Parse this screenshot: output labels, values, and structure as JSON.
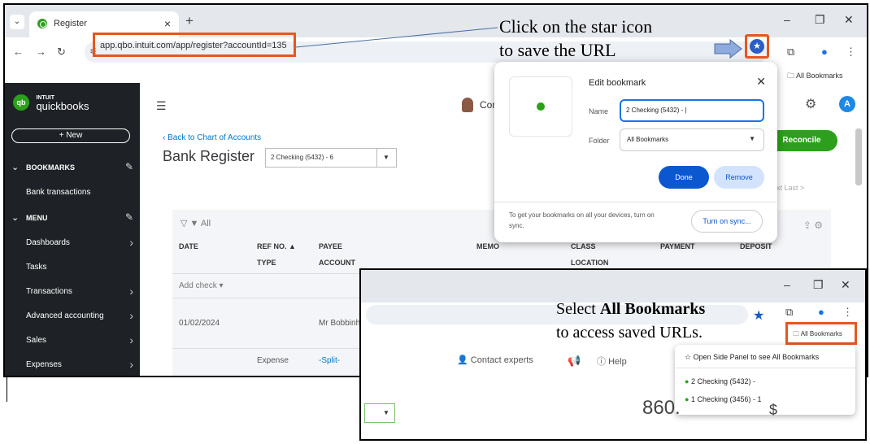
{
  "tab": {
    "title": "Register",
    "close": "×",
    "new": "+"
  },
  "window": {
    "minimize": "–",
    "restore": "❐",
    "close": "✕"
  },
  "address": {
    "url": "app.qbo.intuit.com/app/register?accountId=135"
  },
  "annotation_top": {
    "line1": "Click on the star icon",
    "line2": "to save the URL"
  },
  "bookmarks_bar": {
    "folder": "All Bookmarks"
  },
  "sidebar": {
    "brand_small": "INTUIT",
    "brand_big": "quickbooks",
    "new_button": "+ New",
    "bookmarks_header": "BOOKMARKS",
    "bookmark_item": "Bank transactions",
    "menu_header": "MENU",
    "items": [
      {
        "label": "Dashboards",
        "chevron": true
      },
      {
        "label": "Tasks",
        "chevron": false
      },
      {
        "label": "Transactions",
        "chevron": true
      },
      {
        "label": "Advanced accounting",
        "chevron": true
      },
      {
        "label": "Sales",
        "chevron": true
      },
      {
        "label": "Expenses",
        "chevron": true
      }
    ]
  },
  "main": {
    "contact_short": "Cor",
    "back_link": "Back to Chart of Accounts",
    "title": "Bank Register",
    "account_select": "2 Checking (5432) - 6",
    "reconcile": "Reconcile",
    "pager": "ext  Last >",
    "avatar_letter": "A",
    "filter": "▼ All",
    "columns_row1": [
      "DATE",
      "REF NO. ▲",
      "PAYEE",
      "MEMO",
      "CLASS",
      "PAYMENT",
      "DEPOSIT"
    ],
    "columns_row2": [
      "TYPE",
      "ACCOUNT",
      "LOCATION"
    ],
    "add_check": "Add check",
    "row_date": "01/02/2024",
    "row_payee": "Mr Bobbinh",
    "row_type": "Expense",
    "row_account": "-Split-"
  },
  "bookmark_popup": {
    "title": "Edit bookmark",
    "name_label": "Name",
    "name_value": "2 Checking (5432) - |",
    "folder_label": "Folder",
    "folder_value": "All Bookmarks",
    "done": "Done",
    "remove": "Remove",
    "sync_text": "To get your bookmarks on all your devices, turn on sync.",
    "sync_button": "Turn on sync..."
  },
  "inset": {
    "annotation_prefix": "Select ",
    "annotation_bold": "All Bookmarks",
    "annotation_line2": "to access saved URLs.",
    "all_bookmarks": "All Bookmarks",
    "contact": "Contact experts",
    "help": "Help",
    "menu_open_side": "Open Side Panel to see All Bookmarks",
    "menu_item1": "2 Checking (5432) -",
    "menu_item2": "1 Checking (3456) - 1",
    "big_number": "860.",
    "big_number_tail": "$"
  },
  "colors": {
    "highlight": "#e8561e",
    "qb_green": "#2ca01c",
    "chrome_blue": "#0b57d0"
  }
}
